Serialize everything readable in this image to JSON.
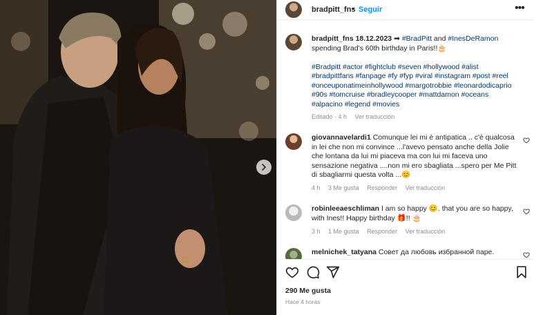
{
  "post": {
    "username": "bradpitt_fns",
    "follow_label": "Seguir",
    "more_label": "•••",
    "caption": {
      "username": "bradpitt_fns",
      "date": "18.12.2023",
      "arrow": "➡",
      "tag_brad": "#BradPitt",
      "and": " and ",
      "tag_ines": "#InesDeRamon",
      "text": "spending Brad's 60th birthday in Paris!!🎂",
      "hashtags_line1": "#Bradpitt #actor #fightclub #seven #hollywood #alist",
      "hashtags_line2": "#bradpittfans #fanpage #fy #fyp #viral #instagram #post #reel",
      "hashtags_line3": "#onceuponatimeinhollywood #margotrobbie #leonardodicaprio",
      "hashtags_line4": "#90s #tomcruise #bradleycooper #mattdamon #oceans",
      "hashtags_line5": "#alpacino #legend #movies",
      "edited": "Editado · 4 h",
      "translate": "Ver traducción"
    },
    "comments": [
      {
        "username": "giovannavelardi1",
        "line1": " Comunque lei mi è antipatica .. c'è qualcosa",
        "line2": "in lei che non mi convince ...l'avevo pensato anche della Jolie",
        "line3": "che lontana da lui mi piaceva ma con lui mi faceva uno",
        "line4": "sensazione negativa ....non mi ero sbagliata ...spero per Me Pitt",
        "line5": "di sbagliarmi questa volta ...😊",
        "time": "4 h",
        "likes": "3 Me gusta",
        "reply": "Responder",
        "translate": "Ver traducción"
      },
      {
        "username": "robinleeaeschliman",
        "line1": " I am so happy 😊. that you are so happy,",
        "line2": "with Ines!! Happy birthday 🎁!! 🎂",
        "time": "3 h",
        "likes": "1 Me gusta",
        "reply": "Responder",
        "translate": "Ver traducción"
      },
      {
        "username": "melnichek_tatyana",
        "line1": " Совет да любовь избранной паре."
      }
    ],
    "likes_count": "290 Me gusta",
    "posted_ago": "Hace 4 horas"
  },
  "icons": {
    "like": "heart-icon",
    "comment": "comment-icon",
    "share": "share-icon",
    "save": "bookmark-icon",
    "next": "chevron-right-icon",
    "more": "more-options-icon"
  },
  "colors": {
    "link_blue": "#0095f6",
    "hashtag": "#00376b",
    "secondary_text": "#8e8e8e",
    "primary_text": "#262626"
  }
}
